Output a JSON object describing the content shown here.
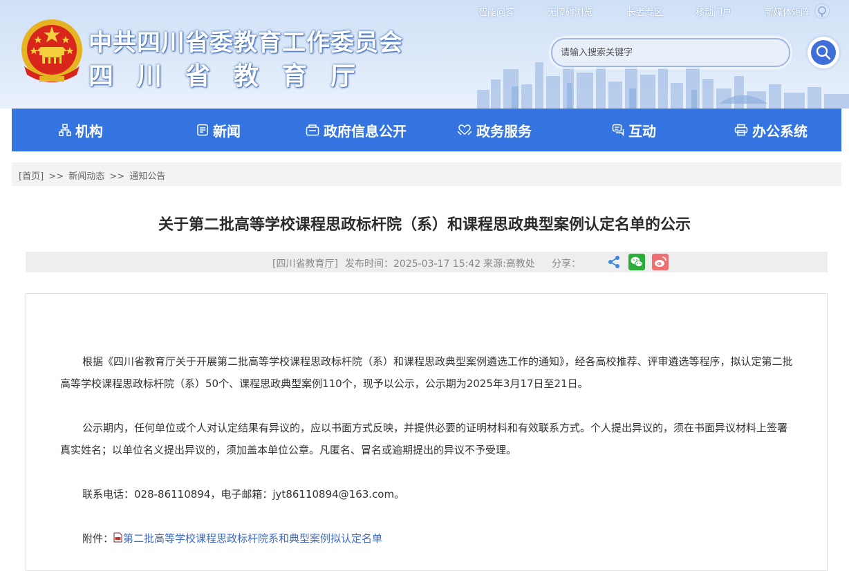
{
  "header": {
    "top_links": [
      "智能问答",
      "无障碍浏览",
      "长者专区",
      "移动门户",
      "新媒体矩阵"
    ],
    "org_title": "中共四川省委教育工作委员会",
    "org_subtitle": "四川省教育厅",
    "search_placeholder": "请输入搜索关键字"
  },
  "nav": {
    "items": [
      {
        "label": "机构",
        "icon": "org-chart-icon"
      },
      {
        "label": "新闻",
        "icon": "newspaper-icon"
      },
      {
        "label": "政府信息公开",
        "icon": "info-disclosure-icon"
      },
      {
        "label": "政务服务",
        "icon": "heart-hands-icon"
      },
      {
        "label": "互动",
        "icon": "chat-icon"
      },
      {
        "label": "办公系统",
        "icon": "printer-icon"
      }
    ]
  },
  "breadcrumb": {
    "items": [
      "[首页]",
      "新闻动态",
      "通知公告"
    ],
    "separator": ">>"
  },
  "article": {
    "title": "关于第二批高等学校课程思政标杆院（系）和课程思政典型案例认定名单的公示",
    "meta": {
      "publisher": "[四川省教育厅]",
      "publish_time": "发布时间：2025-03-17 15:42",
      "source": "来源:高教处",
      "share_label": "分享："
    },
    "share_icons": [
      "share-icon",
      "wechat-icon",
      "weibo-icon"
    ],
    "paragraphs": [
      "根据《四川省教育厅关于开展第二批高等学校课程思政标杆院（系）和课程思政典型案例遴选工作的通知》，经各高校推荐、评审遴选等程序，拟认定第二批高等学校课程思政标杆院（系）50个、课程思政典型案例110个，现予以公示，公示期为2025年3月17日至21日。",
      "公示期内，任何单位或个人对认定结果有异议的，应以书面方式反映，并提供必要的证明材料和有效联系方式。个人提出异议的，须在书面异议材料上签署真实姓名；以单位名义提出异议的，须加盖本单位公章。凡匿名、冒名或逾期提出的异议不予受理。",
      "联系电话：028-86110894，电子邮箱：jyt86110894@163.com。"
    ],
    "attachment_label": "附件：",
    "attachment_link": "第二批高等学校课程思政标杆院系和典型案例拟认定名单"
  },
  "colors": {
    "nav_bg": "#3474e0",
    "header_sky": "#dde9f9",
    "link": "#3f6bc4",
    "wechat": "#2aae37",
    "weibo": "#f07072"
  }
}
